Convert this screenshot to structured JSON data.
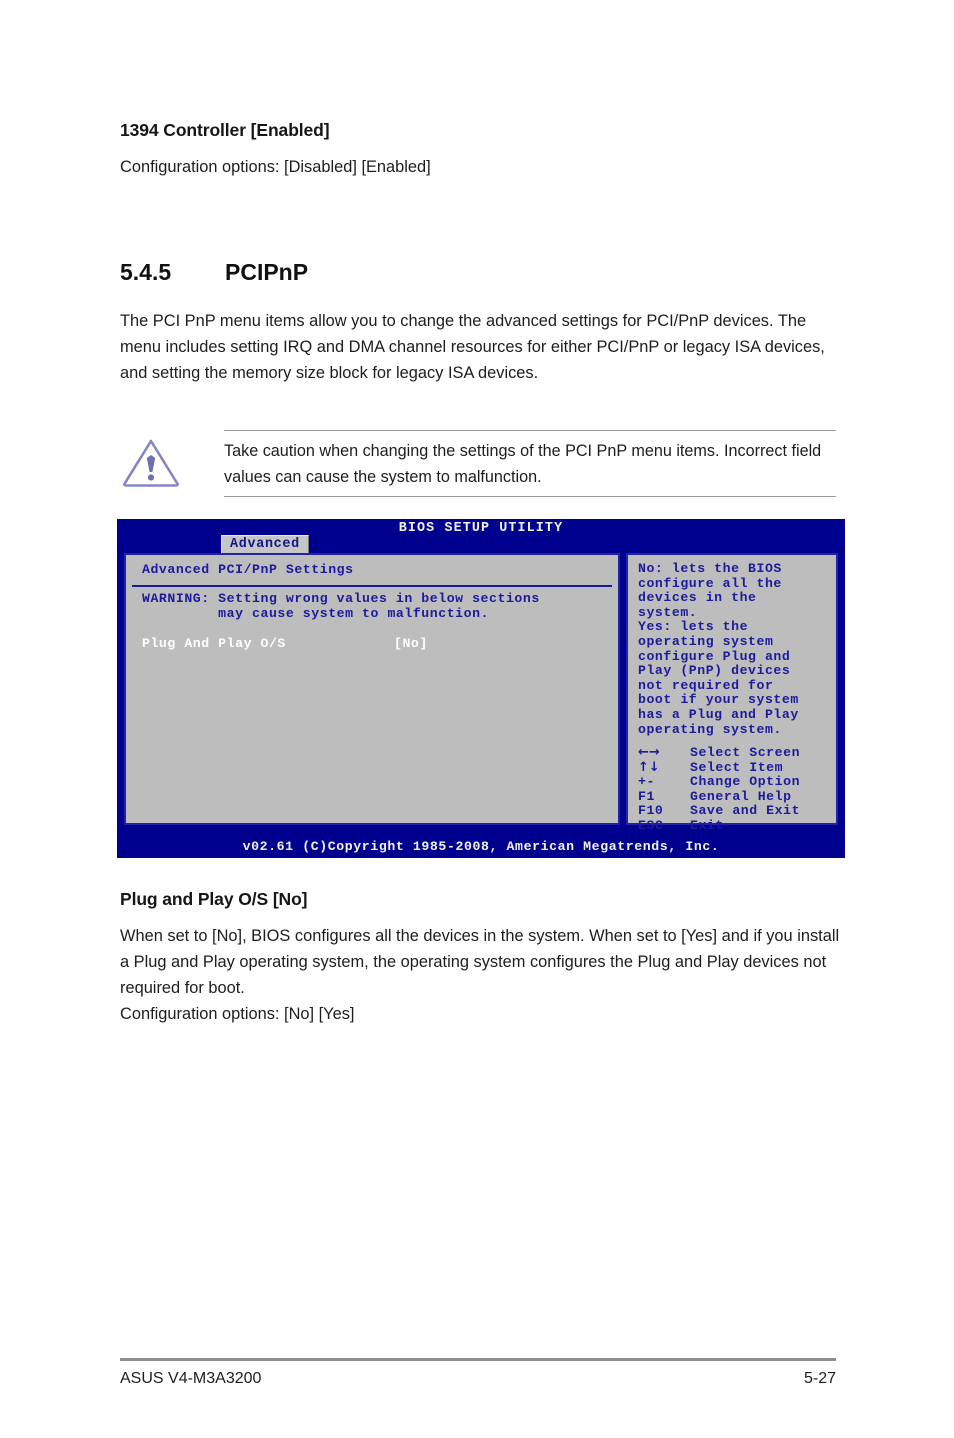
{
  "top_section": {
    "heading": "1394 Controller [Enabled]",
    "config_line": "Configuration options: [Disabled] [Enabled]"
  },
  "section": {
    "number": "5.4.5",
    "title": "PCIPnP",
    "paragraph": "The PCI PnP menu items allow you to change the advanced settings for PCI/PnP devices. The menu includes setting IRQ and DMA channel resources for either PCI/PnP or legacy ISA devices, and setting the memory size block for legacy ISA devices."
  },
  "note": {
    "icon": "caution-triangle-icon",
    "text": "Take caution when changing the settings of the PCI PnP menu items. Incorrect field values can cause the system to malfunction.",
    "icon_color": "#7d7dbe"
  },
  "bios": {
    "title": "BIOS SETUP UTILITY",
    "tab": "Advanced",
    "left_panel": {
      "heading": "Advanced PCI/PnP Settings",
      "warning_line1": "WARNING: Setting wrong values in below sections",
      "warning_line2": "         may cause system to malfunction.",
      "item_label": "Plug And Play O/S",
      "item_value": "[No]"
    },
    "right_panel": {
      "help": "No: lets the BIOS\nconfigure all the\ndevices in the\nsystem.\nYes: lets the\noperating system\nconfigure Plug and\nPlay (PnP) devices\nnot required for\nboot if your system\nhas a Plug and Play\noperating system.",
      "keys": [
        {
          "key": "←→",
          "action": "Select Screen",
          "is_glyph": true
        },
        {
          "key": "↑↓",
          "action": "Select Item",
          "is_glyph": true
        },
        {
          "key": "+-",
          "action": "Change Option",
          "is_glyph": false
        },
        {
          "key": "F1",
          "action": "General Help",
          "is_glyph": false
        },
        {
          "key": "F10",
          "action": "Save and Exit",
          "is_glyph": false
        },
        {
          "key": "ESC",
          "action": "Exit",
          "is_glyph": false
        }
      ]
    },
    "copyright": "v02.61 (C)Copyright 1985-2008, American Megatrends, Inc.",
    "colors": {
      "chrome": "#00008e",
      "panel": "#bdbdbd",
      "panel_border": "#2222a8",
      "text": "#1b1b9c",
      "highlight_text": "#ffffff"
    }
  },
  "bottom_section": {
    "heading": "Plug and Play O/S [No]",
    "paragraph": "When set to [No], BIOS configures all the devices in the system. When set to [Yes] and if you install a Plug and Play operating system, the operating system configures the Plug and Play devices not required for boot.",
    "config_line": "Configuration options: [No] [Yes]"
  },
  "footer": {
    "left": "ASUS V4-M3A3200",
    "page": "5-27"
  }
}
